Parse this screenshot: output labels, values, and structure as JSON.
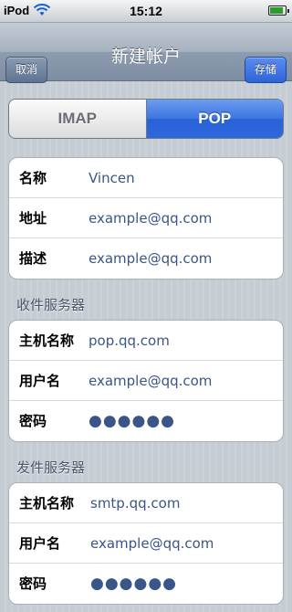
{
  "status_bar": {
    "carrier": "iPod",
    "time": "15:12",
    "battery_level": 0.9
  },
  "nav": {
    "title": "新建帐户",
    "cancel_label": "取消",
    "save_label": "存储"
  },
  "segmented": {
    "options": [
      "IMAP",
      "POP"
    ],
    "selected": "POP"
  },
  "account": {
    "rows": [
      {
        "label": "名称",
        "value": "Vincen"
      },
      {
        "label": "地址",
        "value": "example@qq.com"
      },
      {
        "label": "描述",
        "value": "example@qq.com"
      }
    ]
  },
  "incoming": {
    "header": "收件服务器",
    "rows": [
      {
        "label": "主机名称",
        "value": "pop.qq.com"
      },
      {
        "label": "用户名",
        "value": "example@qq.com"
      },
      {
        "label": "密码",
        "value": "●●●●●●"
      }
    ]
  },
  "outgoing": {
    "header": "发件服务器",
    "rows": [
      {
        "label": "主机名称",
        "value": "smtp.qq.com"
      },
      {
        "label": "用户名",
        "value": "example@qq.com"
      },
      {
        "label": "密码",
        "value": "●●●●●●"
      }
    ]
  },
  "colors": {
    "accent": "#2f63d8",
    "value_text": "#3a5588",
    "section_header": "#4c566c"
  },
  "icons": [
    "wifi-icon",
    "battery-icon"
  ]
}
